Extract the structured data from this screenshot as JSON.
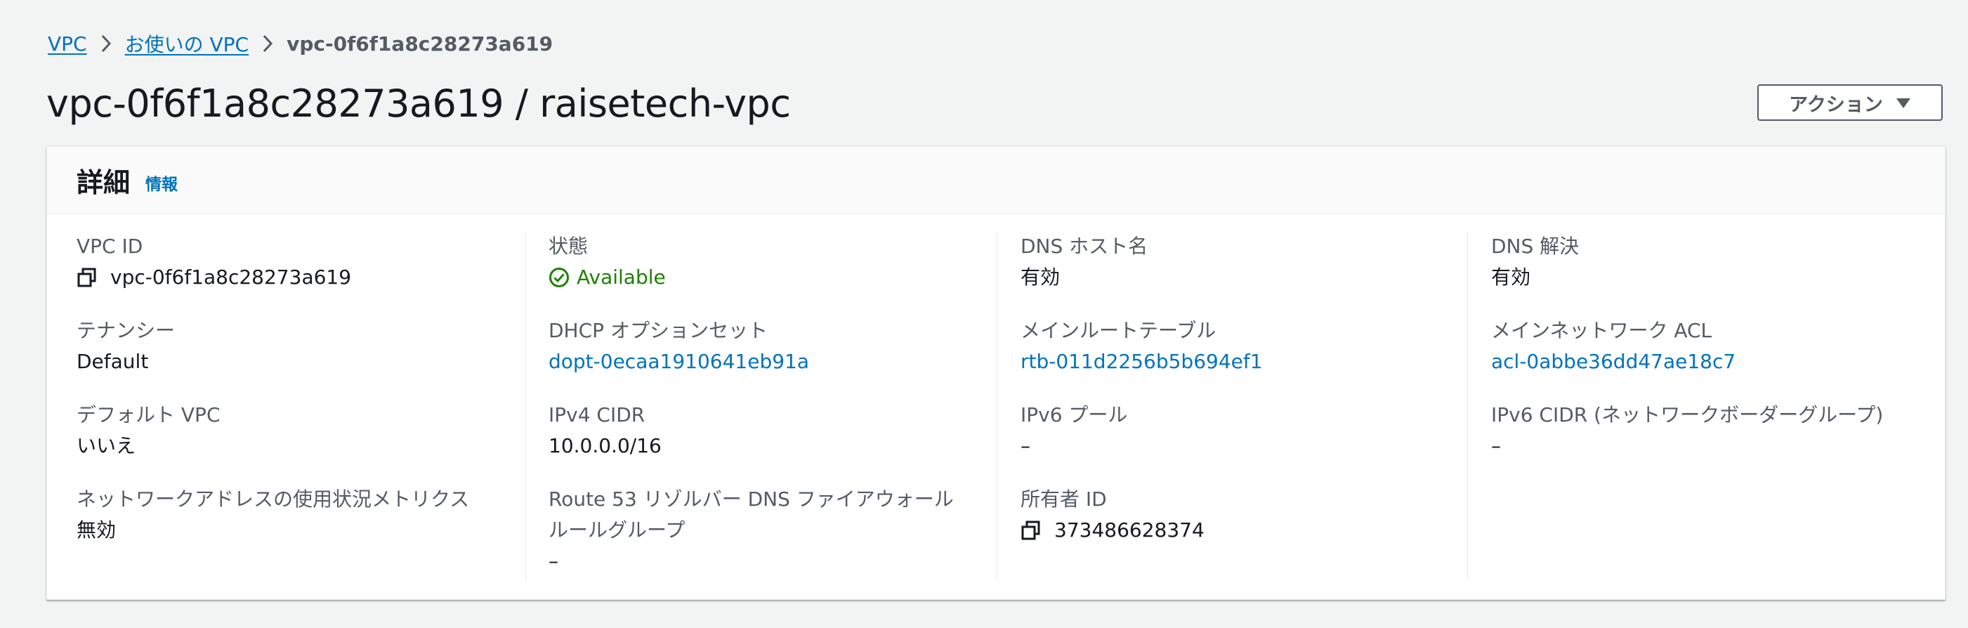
{
  "breadcrumb": {
    "items": [
      "VPC",
      "お使いの VPC"
    ],
    "current": "vpc-0f6f1a8c28273a619"
  },
  "page": {
    "title": "vpc-0f6f1a8c28273a619 / raisetech-vpc",
    "action_label": "アクション"
  },
  "details": {
    "header": "詳細",
    "info_link": "情報",
    "col1": [
      {
        "label": "VPC ID",
        "value": "vpc-0f6f1a8c28273a619"
      },
      {
        "label": "テナンシー",
        "value": "Default"
      },
      {
        "label": "デフォルト VPC",
        "value": "いいえ"
      },
      {
        "label": "ネットワークアドレスの使用状況メトリクス",
        "value": "無効"
      }
    ],
    "col2": [
      {
        "label": "状態",
        "value": "Available"
      },
      {
        "label": "DHCP オプションセット",
        "value": "dopt-0ecaa1910641eb91a"
      },
      {
        "label": "IPv4 CIDR",
        "value": "10.0.0.0/16"
      },
      {
        "label": "Route 53 リゾルバー DNS ファイアウォールルールグループ",
        "value": "–"
      }
    ],
    "col3": [
      {
        "label": "DNS ホスト名",
        "value": "有効"
      },
      {
        "label": "メインルートテーブル",
        "value": "rtb-011d2256b5b694ef1"
      },
      {
        "label": "IPv6 プール",
        "value": "–"
      },
      {
        "label": "所有者 ID",
        "value": "373486628374"
      }
    ],
    "col4": [
      {
        "label": "DNS 解決",
        "value": "有効"
      },
      {
        "label": "メインネットワーク ACL",
        "value": "acl-0abbe36dd47ae18c7"
      },
      {
        "label": "IPv6 CIDR (ネットワークボーダーグループ)",
        "value": "–"
      }
    ]
  },
  "colors": {
    "link": "#0073bb",
    "success": "#1d8102",
    "background": "#f2f3f3"
  },
  "icons": [
    "chevron-right-icon",
    "caret-down-icon",
    "copy-icon",
    "status-available-icon"
  ]
}
